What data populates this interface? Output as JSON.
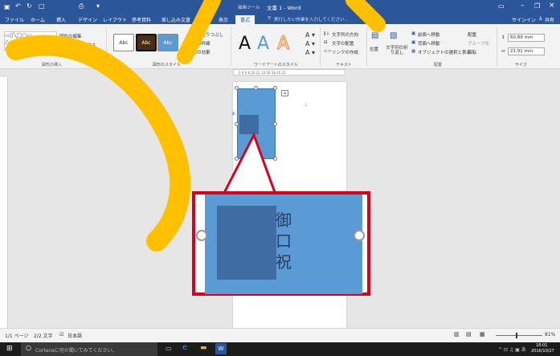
{
  "titlebar": {
    "tool_context": "描画ツール",
    "title": "文書 1 - Word",
    "signin": "サインイン",
    "share": "共有",
    "tellme_placeholder": "実行したい作業を入力してください..."
  },
  "tabs": [
    "ファイル",
    "ホーム",
    "挿入",
    "デザイン",
    "レイアウト",
    "参考資料",
    "差し込み文書",
    "校閲",
    "表示",
    "書式"
  ],
  "ribbon": {
    "insert_shapes": {
      "edit_shape": "図形の編集",
      "textbox": "テキスト ボックス",
      "label": "図形の挿入"
    },
    "styles": {
      "sample1": "Abc",
      "sample2": "Abc",
      "sample3": "Abc",
      "fill": "図形の塗りつぶし",
      "outline": "図形の枠線",
      "effects": "図形の効果",
      "label": "図形のスタイル"
    },
    "wordart": {
      "letter": "A",
      "label": "ワードアートのスタイル"
    },
    "text": {
      "direction": "文字列の方向",
      "align": "文字の配置",
      "link": "リンクの作成",
      "label": "テキスト"
    },
    "arrange": {
      "position": "位置",
      "wrap": "文字列の折り返し",
      "front": "前面へ移動",
      "back": "背面へ移動",
      "selection": "オブジェクトの選択と表示",
      "align": "配置",
      "group": "グループ化",
      "rotate": "回転",
      "label": "配置"
    },
    "size": {
      "height": "60.89 mm",
      "width": "21.91 mm",
      "label": "サイズ"
    }
  },
  "ruler": "2  4  6  8  10  12  14  16  18  20  22",
  "zoom_text": [
    "御",
    "口",
    "祝"
  ],
  "status": {
    "page": "1/1 ページ",
    "words": "2/2 文字",
    "lang": "日本語",
    "zoom": "81%"
  },
  "taskbar": {
    "cortana": "Cortanaに何か聞いてみてください。",
    "time": "18:01",
    "date": "2016/10/27"
  },
  "colors": {
    "word_blue": "#2b579a",
    "shape_blue": "#5b9bd5",
    "callout_red": "#d9001b",
    "overlay_yellow": "#ffc000"
  }
}
